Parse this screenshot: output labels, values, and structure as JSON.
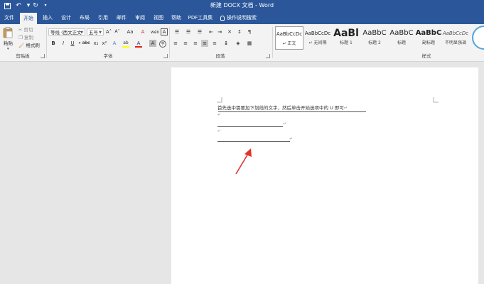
{
  "title_bar": {
    "doc_title": "新建 DOCX 文档 - Word",
    "qat": [
      "save-icon",
      "undo-icon",
      "redo-icon",
      "customize-icon"
    ]
  },
  "tabs": [
    {
      "label": "文件"
    },
    {
      "label": "开始"
    },
    {
      "label": "插入"
    },
    {
      "label": "设计"
    },
    {
      "label": "布局"
    },
    {
      "label": "引用"
    },
    {
      "label": "邮件"
    },
    {
      "label": "审阅"
    },
    {
      "label": "视图"
    },
    {
      "label": "帮助"
    },
    {
      "label": "PDF工具集"
    }
  ],
  "tell_me": {
    "label": "操作说明搜索",
    "icon": "lightbulb-icon"
  },
  "clipboard": {
    "paste_label": "粘贴",
    "cut_label": "剪切",
    "copy_label": "复制",
    "format_painter_label": "格式刷",
    "group_label": "剪贴板"
  },
  "font": {
    "font_name": "等线 (西文正文",
    "font_size": "五号",
    "group_label": "字体",
    "bold": "B",
    "italic": "I",
    "underline": "U",
    "strike": "abc",
    "sub": "x₂",
    "sup": "x²",
    "grow": "A˄",
    "shrink": "A˅",
    "case": "Aa",
    "clear": "A",
    "text_effect": "A",
    "highlight": "ab",
    "color": "A",
    "char_shading": "A",
    "char_border": "A"
  },
  "paragraph": {
    "group_label": "段落"
  },
  "styles": {
    "group_label": "样式",
    "items": [
      {
        "sample": "AaBbCcDc",
        "name": "正文"
      },
      {
        "sample": "AaBbCcDc",
        "name": "无间隔"
      },
      {
        "sample": "AaBl",
        "name": "标题 1"
      },
      {
        "sample": "AaBbC",
        "name": "标题 2"
      },
      {
        "sample": "AaBbC",
        "name": "标题"
      },
      {
        "sample": "AaBbC",
        "name": "副标题"
      },
      {
        "sample": "AaBbCcDc",
        "name": "不明显强调"
      }
    ]
  },
  "document": {
    "line1": "首先选中需要加下划线的文字，然后单击开始选项中的 U 即可",
    "mark": "↵",
    "arrow_color": "#e0342a"
  },
  "colors": {
    "brand": "#2b579a",
    "ribbon_bg": "#f3f3f3",
    "canvas_bg": "#e6e6e6",
    "font_color_bar": "#e02020",
    "highlight_bar": "#ffff00"
  }
}
